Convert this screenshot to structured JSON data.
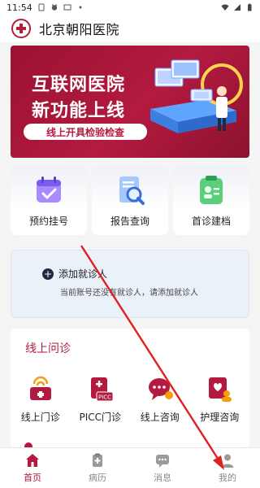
{
  "status_bar": {
    "time": "11:54",
    "left_icons": [
      "phone-settings-icon",
      "cat-icon",
      "screen-icon",
      "dot-icon"
    ],
    "right_icons": [
      "wifi-icon",
      "signal-icon",
      "battery-icon"
    ]
  },
  "header": {
    "logo": "hospital-logo",
    "title": "北京朝阳医院"
  },
  "banner": {
    "line1": "互联网医院",
    "line2": "新功能上线",
    "pill": "线上开具检验检查",
    "illustration": "doctor-computer-illustration"
  },
  "quick_actions": [
    {
      "label": "预约挂号",
      "icon": "calendar-check-icon",
      "accent": "#8a5cf6"
    },
    {
      "label": "报告查询",
      "icon": "report-search-icon",
      "accent": "#3b82f6"
    },
    {
      "label": "首诊建档",
      "icon": "clipboard-profile-icon",
      "accent": "#22c55e"
    }
  ],
  "patient_panel": {
    "add_label": "添加就诊人",
    "hint": "当前账号还没有就诊人，请添加就诊人"
  },
  "online_consult": {
    "title": "线上问诊",
    "items": [
      {
        "label": "线上门诊",
        "icon": "online-clinic-icon"
      },
      {
        "label": "PICC门诊",
        "icon": "picc-icon"
      },
      {
        "label": "线上咨询",
        "icon": "chat-bubble-icon"
      },
      {
        "label": "护理咨询",
        "icon": "nurse-consult-icon"
      }
    ]
  },
  "bottom_nav": [
    {
      "label": "首页",
      "icon": "home-icon",
      "active": true
    },
    {
      "label": "病历",
      "icon": "medical-record-icon",
      "active": false
    },
    {
      "label": "消息",
      "icon": "message-icon",
      "active": false
    },
    {
      "label": "我的",
      "icon": "profile-icon",
      "active": false
    }
  ],
  "colors": {
    "brand": "#b31a3f",
    "annotation_arrow": "#e02020"
  }
}
